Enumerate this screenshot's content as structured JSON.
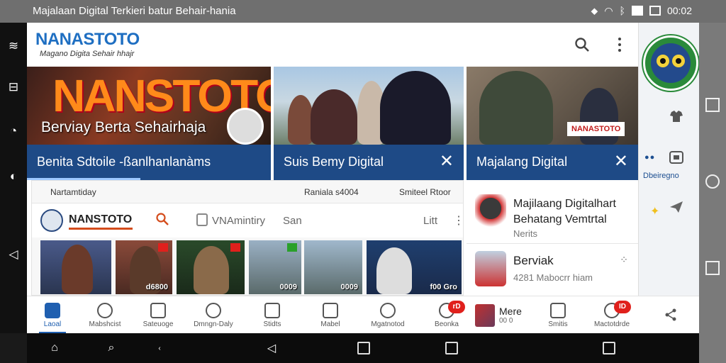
{
  "status_bar": {
    "title": "Majalaan Digital Terkieri batur Behair-hania",
    "time": "00:02",
    "icons": [
      "location-icon",
      "wifi-icon",
      "bluetooth-icon",
      "data-icon",
      "battery-icon"
    ]
  },
  "app_bar": {
    "logo": "NANASTOTO",
    "tagline": "Magano Digita Sehair hhajr"
  },
  "hero_cards": [
    {
      "logo_text": "NANSTOTO",
      "overlay": "Berviay Berta Sehairhaja",
      "caption": "Benita Sdtoile -ßanlhanlanàms"
    },
    {
      "caption": "Suis Bemy Digital",
      "close": "✕"
    },
    {
      "tag": "NANASTOTO",
      "caption": "Majalang Digital",
      "close": "✕"
    }
  ],
  "feed": {
    "meta": [
      "Nartamtiday",
      "Raniala s4004",
      "Smiteel Rtoor"
    ],
    "brand": "NANSTOTO",
    "tab_label": "VNAmintiry",
    "tab2": "San",
    "lit": "Litt",
    "thumbs": [
      {
        "label": ""
      },
      {
        "label": "d6800"
      },
      {
        "label": ""
      },
      {
        "label": "0009"
      },
      {
        "label": "0009"
      },
      {
        "label": "f00 Gro"
      }
    ]
  },
  "right_list": [
    {
      "title_line1": "Majilaang Digitalhart",
      "title_line2": "Behatang Vemtrtal",
      "sub": "Nerits"
    },
    {
      "title": "Berviak",
      "sub": "4281 Mabocrr hiam"
    }
  ],
  "side_panel": {
    "label": "Dbeiregno"
  },
  "bottom_nav": [
    {
      "label": "Laoal",
      "icon": "home-icon",
      "active": true
    },
    {
      "label": "Mabshcist",
      "icon": "user-icon"
    },
    {
      "label": "Sateuoge",
      "icon": "doc-icon"
    },
    {
      "label": "Dmngn-Daly",
      "icon": "zz-icon"
    },
    {
      "label": "Stidts",
      "icon": "grid-icon"
    },
    {
      "label": "Mabel",
      "icon": "camera-icon"
    },
    {
      "label": "Mgatnotod",
      "icon": "person-icon"
    },
    {
      "label": "Beonka",
      "icon": "chat-icon",
      "badge": "rD"
    },
    {
      "label": "Mere",
      "sub": "00 0",
      "icon": "thumb-icon"
    },
    {
      "label": "Smitis",
      "icon": "group-icon"
    },
    {
      "label": "Mactotdrde",
      "icon": "bell-icon",
      "badge": "ID"
    }
  ],
  "colors": {
    "accent": "#1e4a86",
    "brand_blue": "#1f6fc2",
    "badge_red": "#e0201c"
  }
}
